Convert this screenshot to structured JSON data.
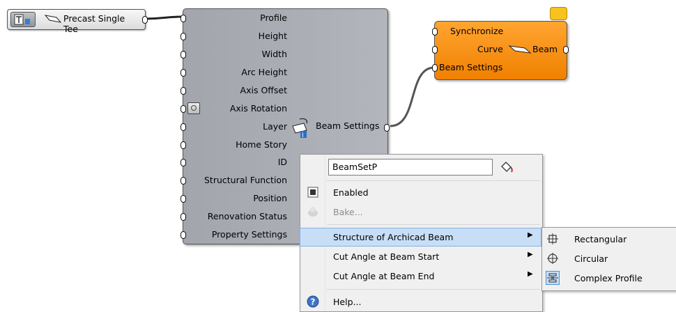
{
  "value_list": {
    "label": "Precast Single Tee"
  },
  "beam_settings": {
    "inputs": [
      "Profile",
      "Height",
      "Width",
      "Arc Height",
      "Axis Offset",
      "Axis Rotation",
      "Layer",
      "Home Story",
      "ID",
      "Structural Function",
      "Position",
      "Renovation Status",
      "Property Settings"
    ],
    "output": "Beam Settings"
  },
  "beam": {
    "inputs": {
      "synchronize": "Synchronize",
      "curve": "Curve",
      "beam_settings": "Beam Settings"
    },
    "output": "Beam"
  },
  "context_menu": {
    "name_value": "BeamSetP",
    "items": {
      "enabled": "Enabled",
      "bake": "Bake...",
      "structure": "Structure of Archicad Beam",
      "cut_start": "Cut Angle at Beam Start",
      "cut_end": "Cut Angle at Beam End",
      "help": "Help..."
    },
    "arrow": "▶"
  },
  "submenu": {
    "items": [
      "Rectangular",
      "Circular",
      "Complex Profile"
    ],
    "selected": "Complex Profile"
  },
  "colors": {
    "component_gray": "#aeb0b8",
    "beam_orange": "#f7921e",
    "menu_highlight": "#c7def6",
    "bubble": "#f8c21f"
  }
}
